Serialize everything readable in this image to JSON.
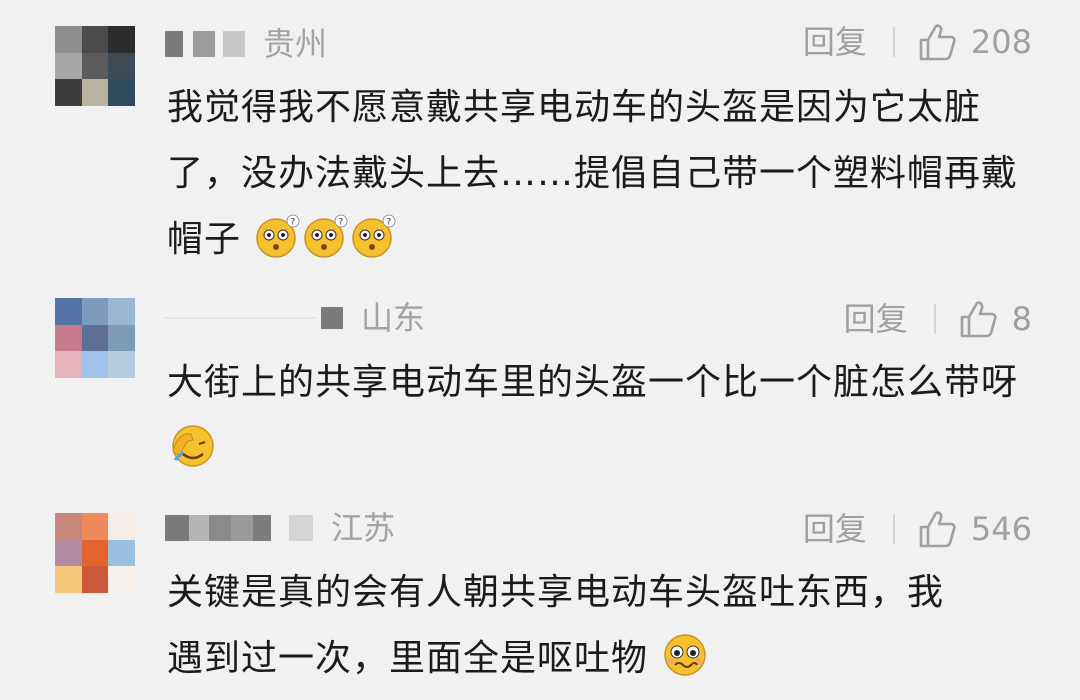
{
  "comments": [
    {
      "location": "贵州",
      "reply_label": "回复",
      "likes": "208",
      "text": "我觉得我不愿意戴共享电动车的头盔是因为它太脏了，没办法戴头上去……提倡自己带一个塑料帽再戴帽子",
      "emojis": [
        "confused-face-emoji",
        "confused-face-emoji",
        "confused-face-emoji"
      ]
    },
    {
      "location": "山东",
      "reply_label": "回复",
      "likes": "8",
      "text": "大街上的共享电动车里的头盔一个比一个脏怎么带呀",
      "emojis": [
        "facepalm-emoji"
      ]
    },
    {
      "location": "江苏",
      "reply_label": "回复",
      "likes": "546",
      "text": "关键是真的会有人朝共享电动车头盔吐东西，我遇到过一次，里面全是呕吐物",
      "emojis": [
        "pleading-face-emoji"
      ]
    }
  ],
  "colors": {
    "background": "#f1f1f1",
    "meta_text": "#a0a0a0",
    "body_text": "#1b1b1b",
    "emoji_yellow": "#f6c12c"
  }
}
